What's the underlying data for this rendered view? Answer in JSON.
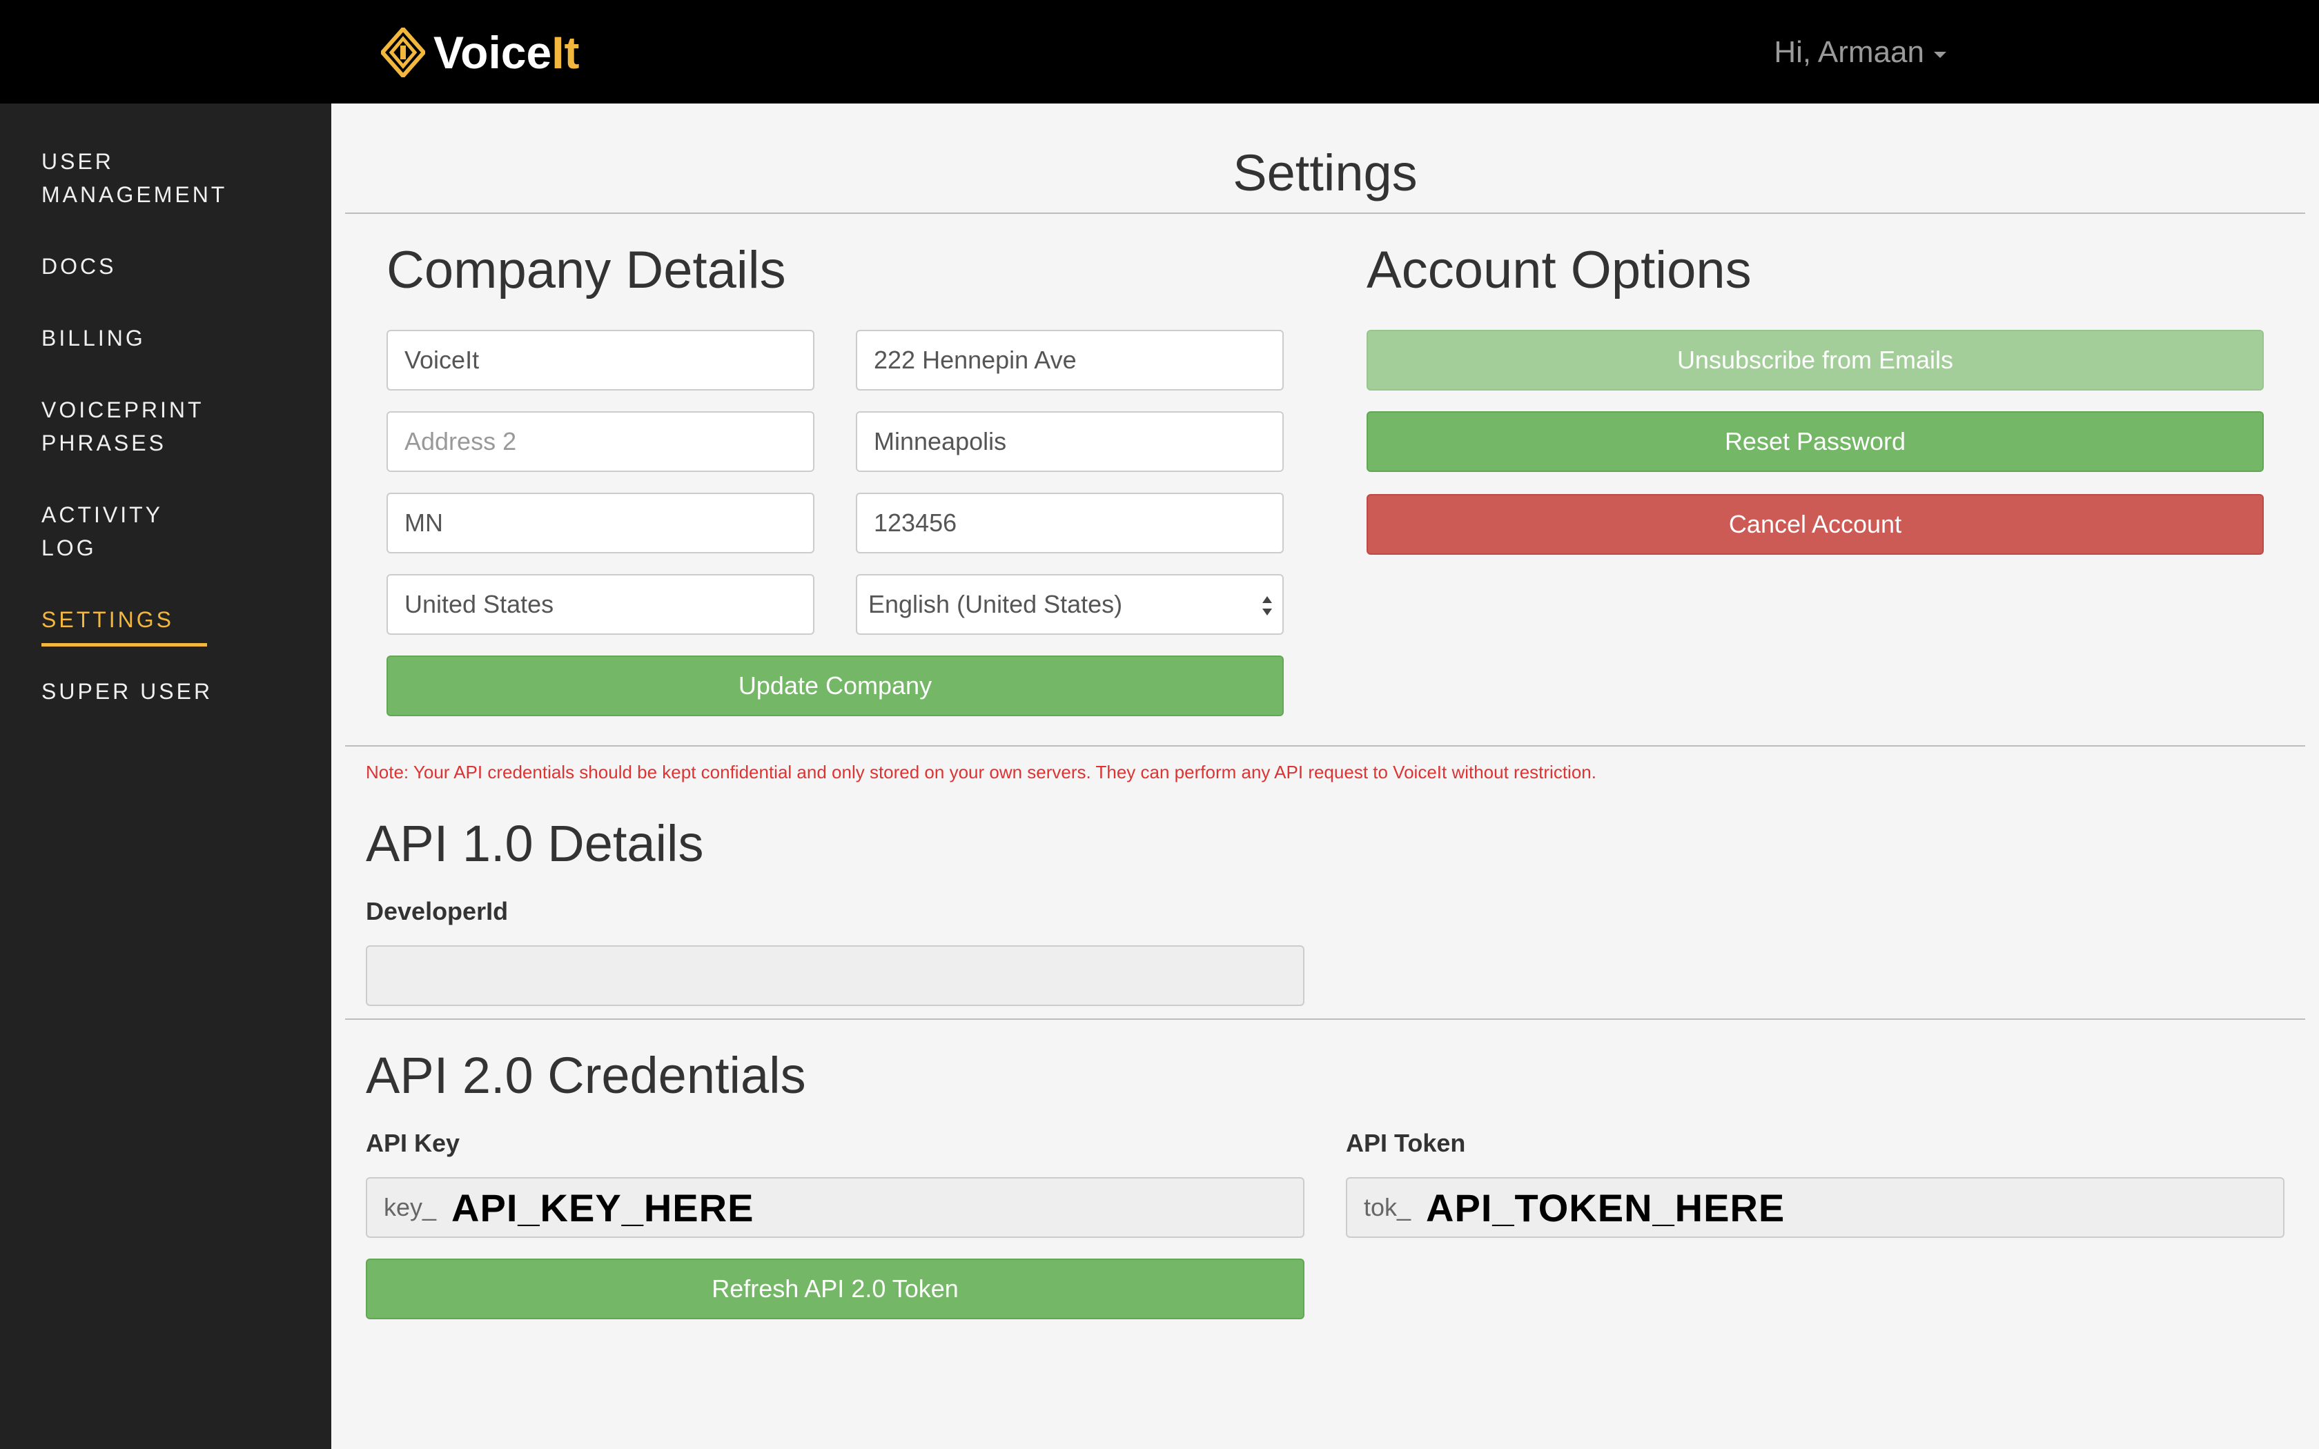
{
  "brand": {
    "name_main": "Voice",
    "name_accent": "It",
    "accent_color": "#f2b73c"
  },
  "header": {
    "greeting": "Hi, Armaan"
  },
  "sidebar": {
    "items": [
      {
        "label_line1": "USER",
        "label_line2": "MANAGEMENT"
      },
      {
        "label_line1": "DOCS",
        "label_line2": ""
      },
      {
        "label_line1": "BILLING",
        "label_line2": ""
      },
      {
        "label_line1": "VOICEPRINT",
        "label_line2": "PHRASES"
      },
      {
        "label_line1": "ACTIVITY",
        "label_line2": "LOG"
      },
      {
        "label_line1": "SETTINGS",
        "label_line2": "",
        "active": true
      },
      {
        "label_line1": "SUPER USER",
        "label_line2": ""
      }
    ]
  },
  "page": {
    "title": "Settings"
  },
  "company": {
    "heading": "Company Details",
    "name": "VoiceIt",
    "address1": "222 Hennepin Ave",
    "address2_placeholder": "Address 2",
    "city": "Minneapolis",
    "state": "MN",
    "zip": "123456",
    "country": "United States",
    "language": "English (United States)",
    "update_button": "Update Company"
  },
  "account": {
    "heading": "Account Options",
    "unsubscribe_button": "Unsubscribe from Emails",
    "reset_button": "Reset Password",
    "cancel_button": "Cancel Account"
  },
  "note": "Note: Your API credentials should be kept confidential and only stored on your own servers. They can perform any API request to VoiceIt without restriction.",
  "api1": {
    "heading": "API 1.0 Details",
    "developer_label": "DeveloperId",
    "developer_value": ""
  },
  "api2": {
    "heading": "API 2.0 Credentials",
    "key_label": "API Key",
    "key_prefix": "key_",
    "key_value": "API_KEY_HERE",
    "token_label": "API Token",
    "token_prefix": "tok_",
    "token_value": "API_TOKEN_HERE",
    "refresh_button": "Refresh API 2.0 Token"
  },
  "colors": {
    "green": "#74b766",
    "green_light": "#a3cd99",
    "red": "#cc5a55",
    "note_red": "#dd3333"
  }
}
